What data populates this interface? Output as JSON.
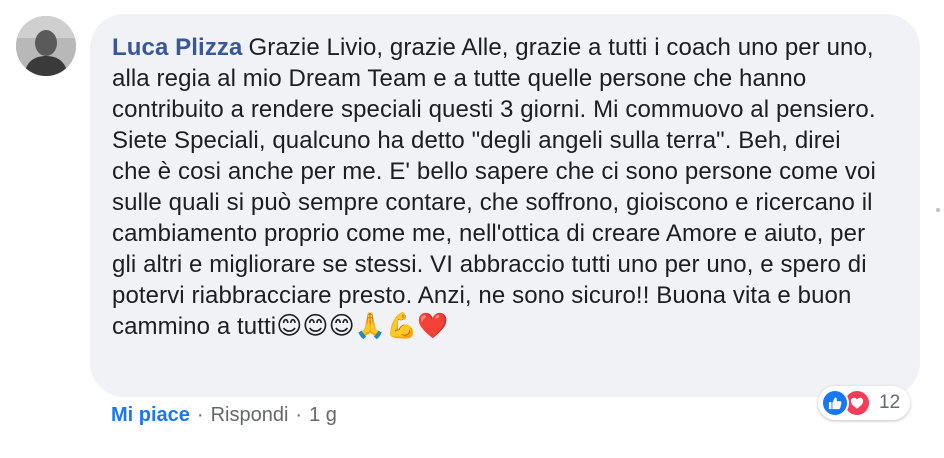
{
  "comment": {
    "author": "Luca Plizza",
    "text": "Grazie Livio, grazie Alle, grazie a tutti i coach uno per uno, alla regia al mio Dream Team e a tutte quelle persone che hanno contribuito a rendere speciali questi 3 giorni. Mi commuovo al pensiero. Siete Speciali, qualcuno ha detto \"degli angeli sulla terra\". Beh, direi che è cosi anche per me. E' bello sapere che ci sono persone come voi sulle quali si può sempre contare, che soffrono, gioiscono e ricercano il cambiamento proprio come me, nell'ottica di creare Amore e aiuto, per gli altri e migliorare se stessi. VI abbraccio tutti uno per uno, e spero di potervi riabbracciare presto. Anzi, ne sono sicuro!! Buona vita e buon cammino a tutti",
    "emojis": [
      "😊",
      "😊",
      "😊",
      "🙏",
      "💪",
      "❤️"
    ]
  },
  "reactions": {
    "types": [
      "like-icon",
      "love-icon"
    ],
    "count": "12",
    "like_color": "#1877f2",
    "love_color": "#f33e58"
  },
  "actions": {
    "like_label": "Mi piace",
    "separator": "·",
    "reply_label": "Rispondi",
    "timestamp": "1 g"
  }
}
